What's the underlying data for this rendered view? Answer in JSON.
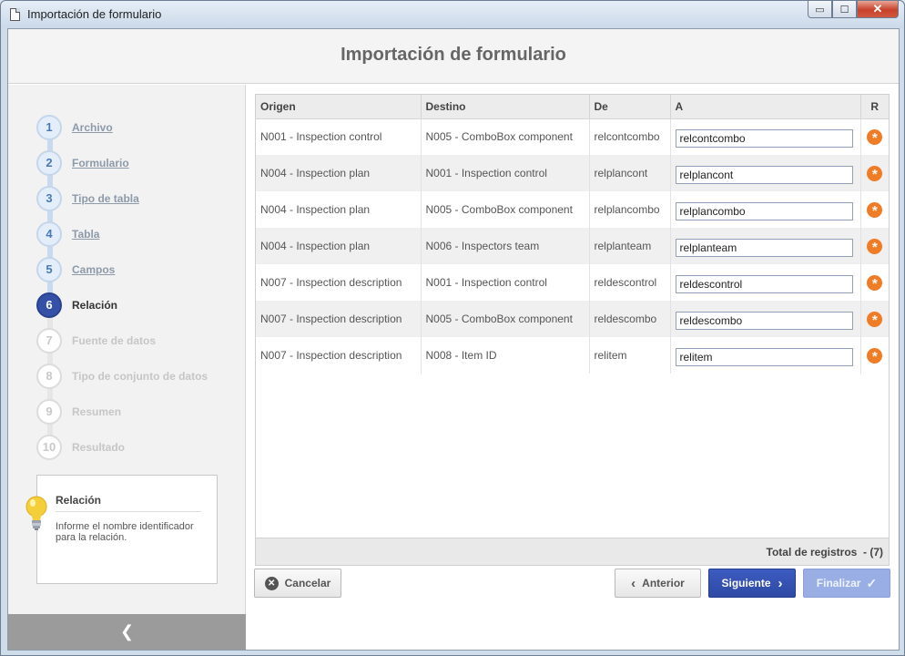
{
  "window": {
    "title": "Importación de formulario"
  },
  "header": {
    "title": "Importación de formulario"
  },
  "steps": [
    {
      "num": "1",
      "label": "Archivo"
    },
    {
      "num": "2",
      "label": "Formulario"
    },
    {
      "num": "3",
      "label": "Tipo de tabla"
    },
    {
      "num": "4",
      "label": "Tabla"
    },
    {
      "num": "5",
      "label": "Campos"
    },
    {
      "num": "6",
      "label": "Relación"
    },
    {
      "num": "7",
      "label": "Fuente de datos"
    },
    {
      "num": "8",
      "label": "Tipo de conjunto de datos"
    },
    {
      "num": "9",
      "label": "Resumen"
    },
    {
      "num": "10",
      "label": "Resultado"
    }
  ],
  "info": {
    "title": "Relación",
    "text": "Informe el nombre identificador para la relación."
  },
  "table": {
    "columns": [
      "Origen",
      "Destino",
      "De",
      "A",
      "R"
    ],
    "rows": [
      {
        "origen": "N001 - Inspection control",
        "destino": "N005 - ComboBox component",
        "de": "relcontcombo",
        "a": "relcontcombo"
      },
      {
        "origen": "N004 - Inspection plan",
        "destino": "N001 - Inspection control",
        "de": "relplancont",
        "a": "relplancont"
      },
      {
        "origen": "N004 - Inspection plan",
        "destino": "N005 - ComboBox component",
        "de": "relplancombo",
        "a": "relplancombo"
      },
      {
        "origen": "N004 - Inspection plan",
        "destino": "N006 - Inspectors team",
        "de": "relplanteam",
        "a": "relplanteam"
      },
      {
        "origen": "N007 - Inspection description",
        "destino": "N001 - Inspection control",
        "de": "reldescontrol",
        "a": "reldescontrol"
      },
      {
        "origen": "N007 - Inspection description",
        "destino": "N005 - ComboBox component",
        "de": "reldescombo",
        "a": "reldescombo"
      },
      {
        "origen": "N007 - Inspection description",
        "destino": "N008 - Item ID",
        "de": "relitem",
        "a": "relitem"
      }
    ],
    "total_label": "Total de registros",
    "total_value": "- (7)"
  },
  "buttons": {
    "cancel": "Cancelar",
    "prev": "Anterior",
    "next": "Siguiente",
    "finish": "Finalizar"
  },
  "window_controls": {
    "minimize": "▭",
    "maximize": "☐",
    "close": "✕"
  },
  "collapse_glyph": "❮"
}
